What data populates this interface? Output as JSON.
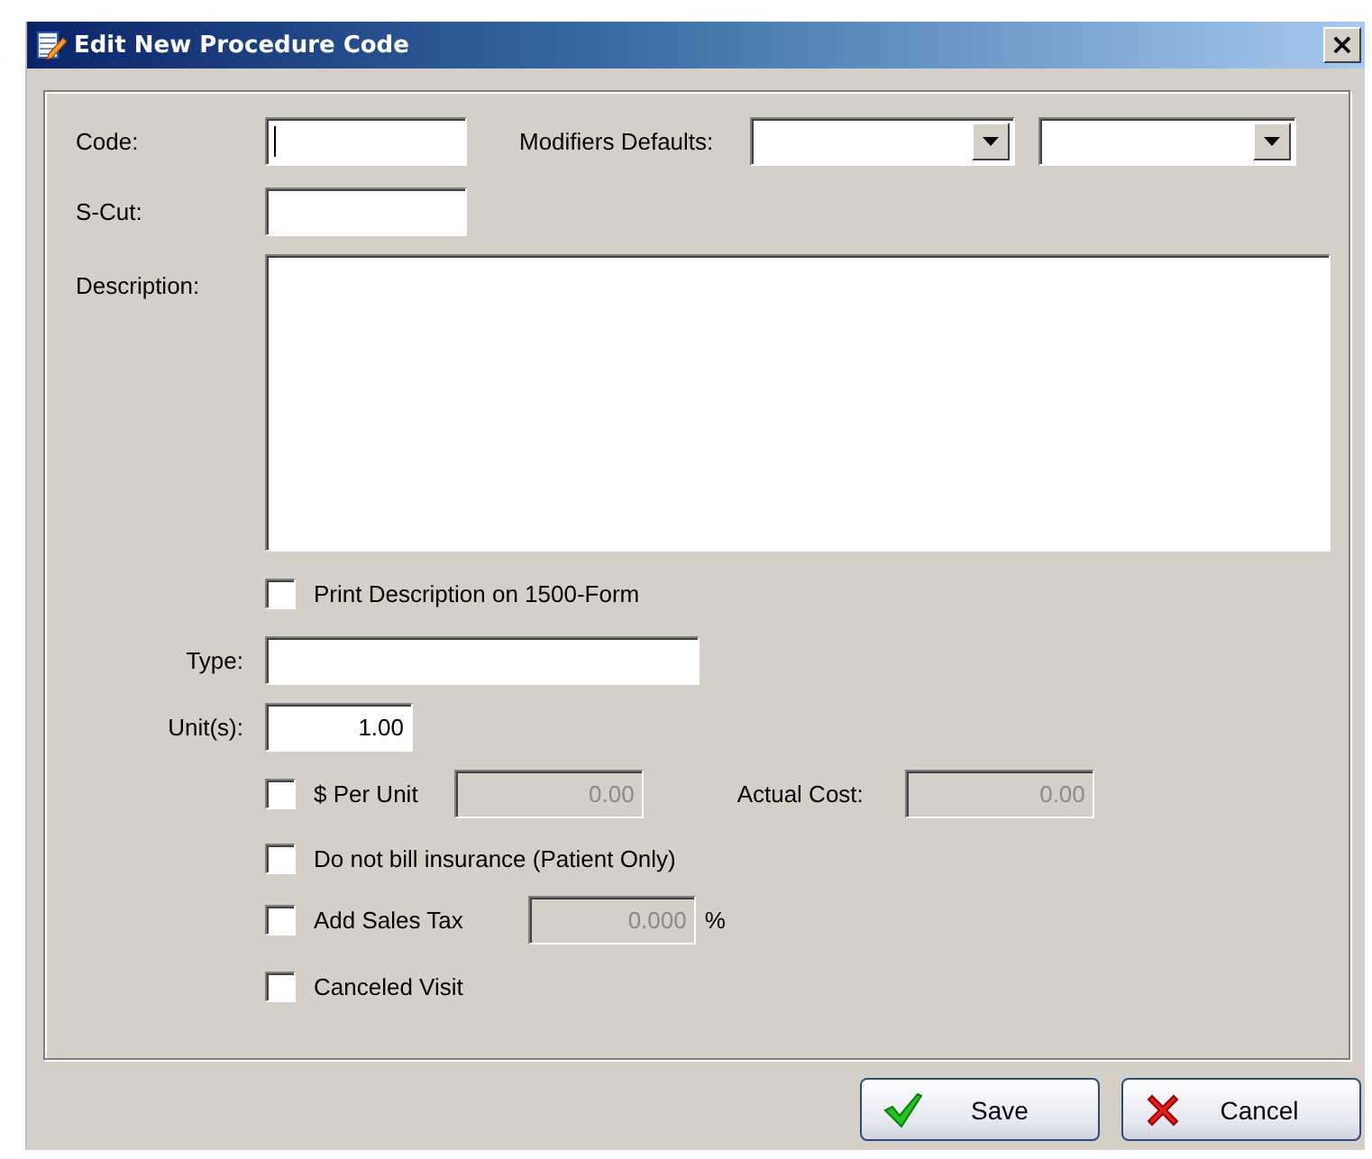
{
  "window": {
    "title": "Edit New Procedure Code",
    "close": "×"
  },
  "code": {
    "label": "Code:",
    "focused": true
  },
  "modifiers": {
    "label": "Modifiers Defaults:"
  },
  "s_cut": {
    "label": "S-Cut:"
  },
  "description": {
    "label": "Description:"
  },
  "print_on_form": {
    "label": "Print Description on 1500-Form",
    "checked": false
  },
  "type": {
    "label": "Type:"
  },
  "units": {
    "label": "Unit(s):",
    "value": "1.00"
  },
  "per_unit": {
    "label": "$ Per Unit",
    "checked": false,
    "value": "0.00",
    "disabled": true
  },
  "actual_cost": {
    "label": "Actual Cost:",
    "value": "0.00",
    "disabled": true
  },
  "no_bill": {
    "label": "Do not bill insurance (Patient Only)",
    "checked": false
  },
  "sales_tax": {
    "label": "Add Sales Tax",
    "checked": false,
    "value": "0.000",
    "disabled": true,
    "unit": "%"
  },
  "canceled": {
    "label": "Canceled Visit",
    "checked": false
  },
  "buttons": [
    {
      "label": "Save",
      "kind": "save"
    },
    {
      "label": "Cancel",
      "kind": "cancel"
    }
  ]
}
